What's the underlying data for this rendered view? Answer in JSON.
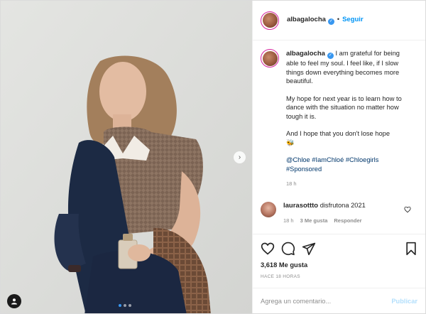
{
  "post": {
    "username": "albagalocha",
    "follow_label": "Seguir",
    "caption_paragraphs": [
      "I am grateful for being able to feel my soul. I feel like, if I slow things down everything becomes more beautiful.",
      "My hope for next year is to learn how to dance with the situation no matter how tough it is.",
      "And I hope that you don't lose hope"
    ],
    "caption_emoji": "🐝",
    "hashtags": "@Chloe #IamChloé #Chloegirls #Sponsored",
    "caption_time": "18 h",
    "likes": "3,618 Me gusta",
    "posted_ago": "HACE 18 HORAS"
  },
  "comments": [
    {
      "username": "laurasottto",
      "text": "disfrutona 2021",
      "time": "18 h",
      "likes": "3 Me gusta",
      "reply_label": "Responder"
    }
  ],
  "composer": {
    "placeholder": "Agrega un comentario...",
    "post_label": "Publicar"
  },
  "carousel": {
    "count": 3,
    "active_index": 0
  },
  "colors": {
    "accent": "#0095f6",
    "link": "#00376b",
    "muted": "#8e8e8e"
  }
}
